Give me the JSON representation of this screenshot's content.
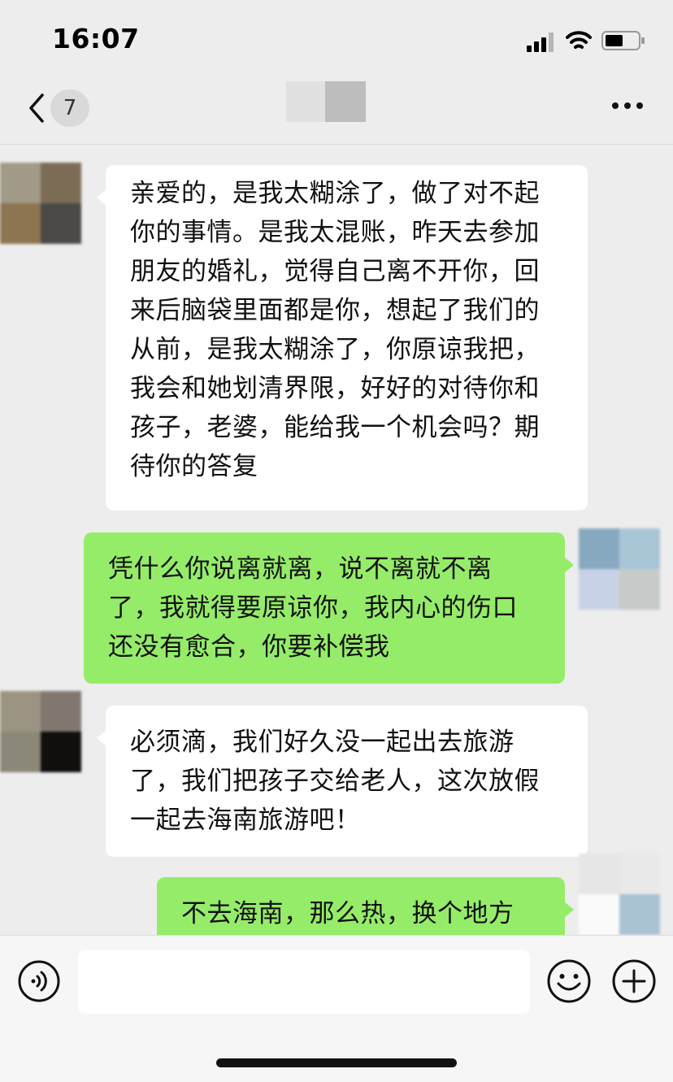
{
  "status_bar": {
    "time": "16:07",
    "signal_icon": "cellular-signal-icon",
    "wifi_icon": "wifi-icon",
    "battery_icon": "battery-icon"
  },
  "nav": {
    "back_icon": "chevron-left-icon",
    "unread_count": "7",
    "more_icon": "ellipsis-icon"
  },
  "messages": [
    {
      "side": "incoming",
      "text": "亲爱的，是我太糊涂了，做了对不起你的事情。是我太混账，昨天去参加朋友的婚礼，觉得自己离不开你，回来后脑袋里面都是你，想起了我们的从前，是我太糊涂了，你原谅我把，我会和她划清界限，好好的对待你和孩子，老婆，能给我一个机会吗？期待你的答复"
    },
    {
      "side": "outgoing",
      "text": "凭什么你说离就离，说不离就不离了，我就得要原谅你，我内心的伤口还没有愈合，你要补偿我"
    },
    {
      "side": "incoming",
      "text": "必须滴，我们好久没一起出去旅游了，我们把孩子交给老人，这次放假一起去海南旅游吧！"
    },
    {
      "side": "outgoing",
      "text": "不去海南，那么热，换个地方"
    }
  ],
  "input_bar": {
    "voice_icon": "voice-input-icon",
    "text_value": "",
    "emoji_icon": "emoji-icon",
    "plus_icon": "plus-circle-icon"
  },
  "colors": {
    "background": "#ededed",
    "incoming_bubble": "#ffffff",
    "outgoing_bubble": "#95ec69"
  }
}
